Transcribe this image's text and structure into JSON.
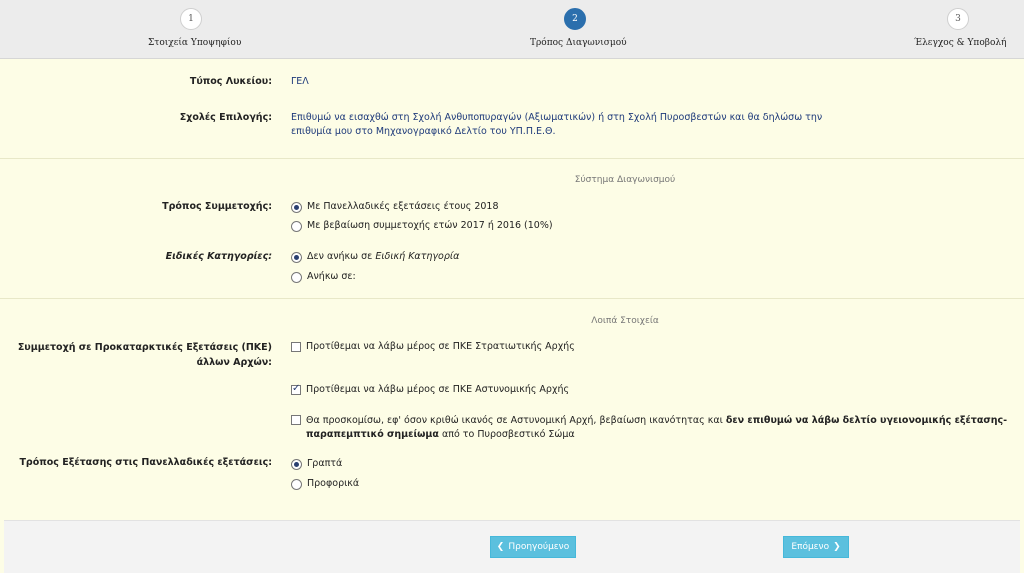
{
  "steps": [
    {
      "number": "1",
      "label": "Στοιχεία Υποψηφίου"
    },
    {
      "number": "2",
      "label": "Τρόπος Διαγωνισμού"
    },
    {
      "number": "3",
      "label": "Έλεγχος & Υποβολή"
    }
  ],
  "school_type": {
    "label": "Τύπος Λυκείου:",
    "value": "ΓΕΛ"
  },
  "schools": {
    "label": "Σχολές Επιλογής:",
    "value": "Επιθυμώ να εισαχθώ στη Σχολή Ανθυποπυραγών (Αξιωματικών) ή στη Σχολή Πυροσβεστών και θα δηλώσω την επιθυμία μου στο Μηχανογραφικό Δελτίο του ΥΠ.Π.Ε.Θ."
  },
  "section_system": "Σύστημα Διαγωνισμού",
  "participation": {
    "label": "Τρόπος Συμμετοχής:",
    "options": [
      "Με Πανελλαδικές εξετάσεις έτους 2018",
      "Με βεβαίωση συμμετοχής ετών 2017 ή 2016 (10%)"
    ],
    "selected": "Με Πανελλαδικές εξετάσεις έτους 2018"
  },
  "special": {
    "label": "Ειδικές Κατηγορίες:",
    "option1_prefix": "Δεν ανήκω σε ",
    "option1_em": "Ειδική Κατηγορία",
    "option2": "Ανήκω σε:",
    "selected": "Δεν ανήκω σε Ειδική Κατηγορία"
  },
  "section_other": "Λοιπά Στοιχεία",
  "pke": {
    "label": "Συμμετοχή σε Προκαταρκτικές Εξετάσεις (ΠΚΕ) άλλων Αρχών:",
    "option1": "Προτίθεμαι να λάβω μέρος σε ΠΚΕ Στρατιωτικής Αρχής",
    "option2": "Προτίθεμαι να λάβω μέρος σε ΠΚΕ Αστυνομικής Αρχής",
    "option3_text": "Θα προσκομίσω, εφ' όσον κριθώ ικανός σε Αστυνομική Αρχή, βεβαίωση ικανότητας και ",
    "option3_bold": "δεν επιθυμώ να λάβω δελτίο υγειονομικής εξέτασης-παραπεμπτικό σημείωμα",
    "option3_tail": " από το Πυροσβεστικό Σώμα",
    "checked": [
      "Προτίθεμαι να λάβω μέρος σε ΠΚΕ Αστυνομικής Αρχής"
    ]
  },
  "exam_mode": {
    "label": "Τρόπος Εξέτασης στις Πανελλαδικές εξετάσεις:",
    "options": [
      "Γραπτά",
      "Προφορικά"
    ],
    "selected": "Γραπτά"
  },
  "buttons": {
    "prev": "Προηγούμενο",
    "next": "Επόμενο",
    "prev_icon": "❮",
    "next_icon": "❯"
  },
  "colors": {
    "accent": "#2b6fad",
    "button": "#5bc0de",
    "background": "#fdfde6"
  }
}
